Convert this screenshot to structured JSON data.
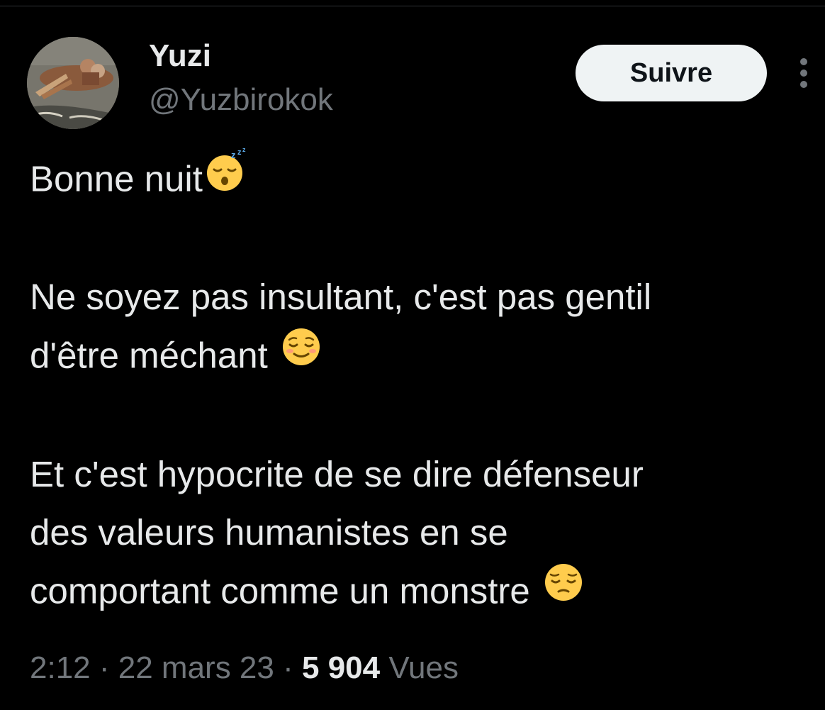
{
  "author": {
    "display_name": "Yuzi",
    "handle": "@Yuzbirokok"
  },
  "follow_label": "Suivre",
  "tweet": {
    "line1": "Bonne nuit",
    "line2a": "Ne soyez pas insultant, c'est pas gentil",
    "line2b": "d'être méchant",
    "line3a": "Et c'est hypocrite de se dire défenseur",
    "line3b": "des valeurs humanistes en se",
    "line3c": "comportant comme un monstre",
    "emojis": [
      "sleeping-face",
      "relieved-face",
      "pensive-face"
    ]
  },
  "meta": {
    "time": "2:12",
    "sep1": "·",
    "date": "22 mars 23",
    "sep2": "·",
    "views_count": "5 904",
    "views_label": "Vues"
  },
  "colors": {
    "background": "#000000",
    "text": "#e7e9ea",
    "secondary": "#71767b",
    "button_bg": "#eff3f4",
    "button_text": "#0f1419"
  }
}
